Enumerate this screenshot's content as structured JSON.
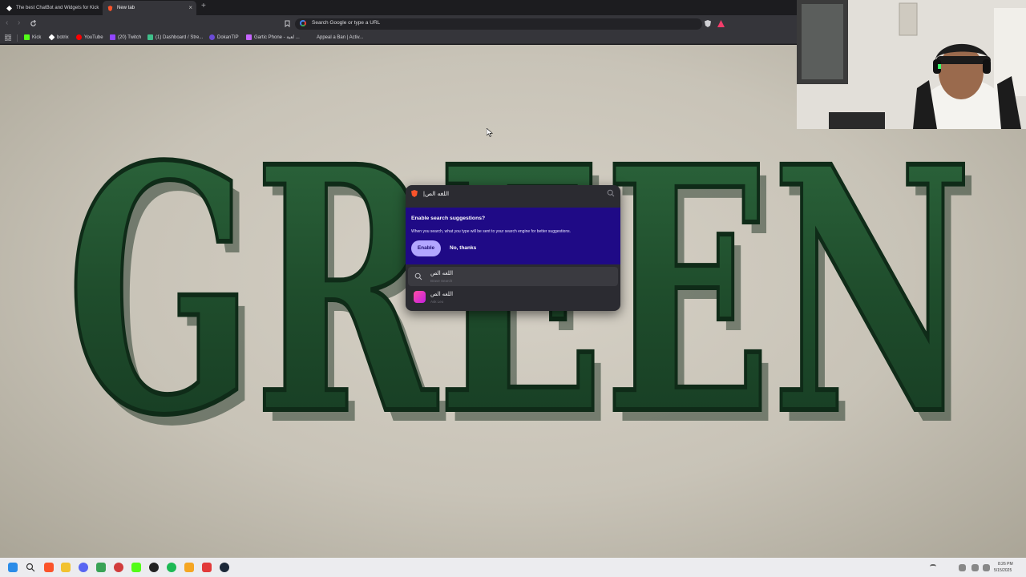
{
  "browser": {
    "tabs": [
      {
        "title": "The best ChatBot and Widgets for Kick",
        "active": false
      },
      {
        "title": "New tab",
        "active": true
      }
    ],
    "new_tab_symbol": "+",
    "close_symbol": "×",
    "address_placeholder": "Search Google or type a URL",
    "bookmarks": [
      {
        "label": "Kick",
        "icon": "kick-icon",
        "color": "#53fc18"
      },
      {
        "label": "botrix",
        "icon": "botrix-icon",
        "color": "#ffffff"
      },
      {
        "label": "YouTube",
        "icon": "youtube-icon",
        "color": "#ff0000"
      },
      {
        "label": "(20) Twitch",
        "icon": "twitch-icon",
        "color": "#9146ff"
      },
      {
        "label": "(1) Dashboard / Stre...",
        "icon": "dashboard-icon",
        "color": "#3fbf8a"
      },
      {
        "label": "DokanTIP",
        "icon": "dokantip-icon",
        "color": "#6b4bd6"
      },
      {
        "label": "Gartic Phone - لعبة ...",
        "icon": "gartic-icon",
        "color": "#c565ff"
      },
      {
        "label": "Appeal a Ban | Activ...",
        "icon": "activision-icon",
        "color": "#222222"
      }
    ]
  },
  "wallpaper": {
    "word": "GREEN"
  },
  "omnibox": {
    "input_value": "اللغه الص|",
    "suggestion_prompt": {
      "title": "Enable search suggestions?",
      "description": "When you search, what you type will be sent to your search engine for better suggestions.",
      "enable_label": "Enable",
      "no_thanks_label": "No, thanks"
    },
    "results": [
      {
        "main": "اللغه الص",
        "sub": "Brave Search",
        "icon": "search-icon"
      },
      {
        "main": "اللغه الص",
        "sub": "Ask Leo",
        "icon": "leo-icon"
      }
    ]
  },
  "taskbar": {
    "time": "8:26 PM",
    "date": "5/15/2025"
  },
  "colors": {
    "accent_purple": "#1f0a86",
    "enable_button": "#b2a6ff",
    "green_letters": "#1e4a2b"
  }
}
